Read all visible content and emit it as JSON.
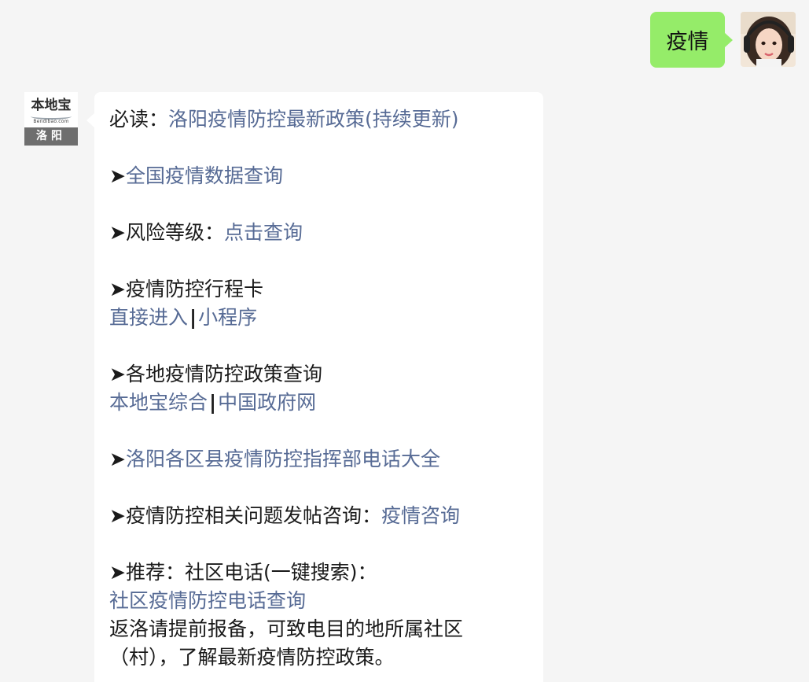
{
  "outgoing": {
    "text": "疫情"
  },
  "bot": {
    "logo_main": "本地宝",
    "logo_sub": "Bendibao.com",
    "logo_city": "洛阳"
  },
  "message": {
    "must_read_label": "必读：",
    "must_read_link": "洛阳疫情防控最新政策(持续更新)",
    "arrow": "➤",
    "national_data_link": "全国疫情数据查询",
    "risk_label": "风险等级：",
    "risk_link": "点击查询",
    "itinerary_label": "疫情防控行程卡",
    "itinerary_direct_link": "直接进入",
    "separator": "|",
    "itinerary_miniprogram_link": "小程序",
    "policy_label": "各地疫情防控政策查询",
    "policy_bendibao_link": "本地宝综合",
    "policy_gov_link": "中国政府网",
    "hotline_link": "洛阳各区县疫情防控指挥部电话大全",
    "consult_label": "疫情防控相关问题发帖咨询：",
    "consult_link": "疫情咨询",
    "recommend_label": "推荐：社区电话(一键搜索)：",
    "community_link": "社区疫情防控电话查询",
    "notice_text": "返洛请提前报备，可致电目的地所属社区（村），了解最新疫情防控政策。"
  }
}
